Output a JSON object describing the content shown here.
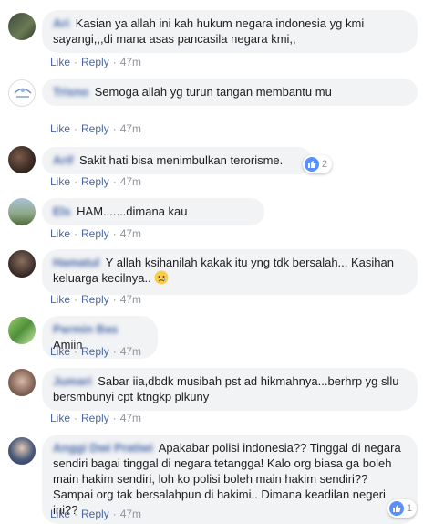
{
  "actions": {
    "like": "Like",
    "reply": "Reply",
    "sep": "·"
  },
  "comments": [
    {
      "name": "Ari",
      "text": "Kasian ya allah ini kah hukum negara indonesia yg kmi sayangi,,,di mana asas pancasila negara kmi,,",
      "time": "47m"
    },
    {
      "name": "Trisno",
      "text": "Semoga allah yg turun tangan membantu mu",
      "time": "47m"
    },
    {
      "name": "Arif",
      "text": "Sakit hati bisa menimbulkan terorisme.",
      "time": "47m",
      "reactions": "2"
    },
    {
      "name": "Els",
      "text": "HAM.......dimana kau",
      "time": "47m"
    },
    {
      "name": "Hamatul",
      "text": "Y allah ksihanilah kakak itu yng tdk bersalah... Kasihan keluarga kecilnya..",
      "time": "47m",
      "emoji": "sad-tear-emoji"
    },
    {
      "name": "Parmin Bas",
      "text": "Amiin",
      "time": "47m"
    },
    {
      "name": "Jumari",
      "text": "Sabar iia,dbdk musibah pst ad hikmahnya...berhrp yg sllu bersmbunyi cpt ktngkp plkuny",
      "time": "47m"
    },
    {
      "name": "Anggi Dwi Pratiwi",
      "text": "Apakabar polisi indonesia?? Tinggal di negara sendiri bagai tinggal di negara tetangga! Kalo org biasa ga boleh main hakim sendiri, loh ko polisi boleh main hakim sendiri?? Sampai org tak bersalahpun di hakimi.. Dimana keadilan negeri ini??",
      "time": "47m",
      "reactions": "1"
    }
  ],
  "colors": {
    "link": "#385898",
    "bubble": "#f2f3f5",
    "meta": "#90949c",
    "like_blue": "#5890ff"
  }
}
